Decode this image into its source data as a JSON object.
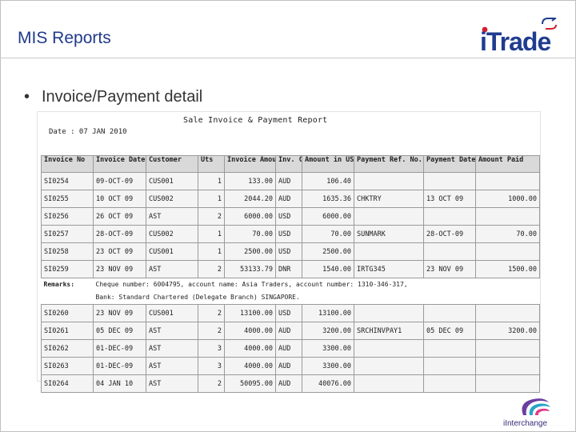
{
  "header": {
    "title": "MIS Reports",
    "logo_text": "iTrade"
  },
  "bullet": {
    "symbol": "•",
    "text": "Invoice/Payment detail"
  },
  "report": {
    "title": "Sale Invoice & Payment Report",
    "date_line": "Date : 07 JAN 2010",
    "columns": [
      "Invoice No",
      "Invoice Date",
      "Customer",
      "Uts",
      "Invoice Amount",
      "Inv. Curr",
      "Amount in USD",
      "Payment Ref. No.",
      "Payment Date",
      "Amount Paid"
    ],
    "rows": [
      {
        "no": "SI0254",
        "date": "09-OCT-09",
        "customer": "CUS001",
        "uts": "1",
        "amount": "133.00",
        "curr": "AUD",
        "usd": "106.40",
        "ref": "",
        "pdate": "",
        "paid": ""
      },
      {
        "no": "SI0255",
        "date": "10 OCT 09",
        "customer": "CUS002",
        "uts": "1",
        "amount": "2044.20",
        "curr": "AUD",
        "usd": "1635.36",
        "ref": "CHKTRY",
        "pdate": "13 OCT 09",
        "paid": "1000.00"
      },
      {
        "no": "SI0256",
        "date": "26 OCT 09",
        "customer": "AST",
        "uts": "2",
        "amount": "6000.00",
        "curr": "USD",
        "usd": "6000.00",
        "ref": "",
        "pdate": "",
        "paid": ""
      },
      {
        "no": "SI0257",
        "date": "28-OCT-09",
        "customer": "CUS002",
        "uts": "1",
        "amount": "70.00",
        "curr": "USD",
        "usd": "70.00",
        "ref": "SUNMARK",
        "pdate": "28-OCT-09",
        "paid": "70.00"
      },
      {
        "no": "SI0258",
        "date": "23 OCT 09",
        "customer": "CUS001",
        "uts": "1",
        "amount": "2500.00",
        "curr": "USD",
        "usd": "2500.00",
        "ref": "",
        "pdate": "",
        "paid": ""
      },
      {
        "no": "SI0259",
        "date": "23 NOV 09",
        "customer": "AST",
        "uts": "2",
        "amount": "53133.79",
        "curr": "DNR",
        "usd": "1540.00",
        "ref": "IRTG345",
        "pdate": "23 NOV 09",
        "paid": "1500.00"
      }
    ],
    "remarks_label": "Remarks:",
    "remarks_line1": "Cheque number: 6004795, account name: Asia Traders, account number: 1310-346-317,",
    "remarks_line2": "Bank: Standard Chartered (Delegate Branch) SINGAPORE.",
    "rows2": [
      {
        "no": "SI0260",
        "date": "23 NOV 09",
        "customer": "CUS001",
        "uts": "2",
        "amount": "13100.00",
        "curr": "USD",
        "usd": "13100.00",
        "ref": "",
        "pdate": "",
        "paid": ""
      },
      {
        "no": "SI0261",
        "date": "05 DEC 09",
        "customer": "AST",
        "uts": "2",
        "amount": "4000.00",
        "curr": "AUD",
        "usd": "3200.00",
        "ref": "SRCHINVPAY1",
        "pdate": "05 DEC 09",
        "paid": "3200.00"
      },
      {
        "no": "SI0262",
        "date": "01-DEC-09",
        "customer": "AST",
        "uts": "3",
        "amount": "4000.00",
        "curr": "AUD",
        "usd": "3300.00",
        "ref": "",
        "pdate": "",
        "paid": ""
      },
      {
        "no": "SI0263",
        "date": "01-DEC-09",
        "customer": "AST",
        "uts": "3",
        "amount": "4000.00",
        "curr": "AUD",
        "usd": "3300.00",
        "ref": "",
        "pdate": "",
        "paid": ""
      },
      {
        "no": "SI0264",
        "date": "04 JAN 10",
        "customer": "AST",
        "uts": "2",
        "amount": "50095.00",
        "curr": "AUD",
        "usd": "40076.00",
        "ref": "",
        "pdate": "",
        "paid": ""
      }
    ]
  },
  "footer": {
    "logo_text": "iInterchange"
  },
  "colors": {
    "title_blue": "#1f3a8a",
    "brand_blue": "#1f3c8f",
    "brand_red": "#d0202e",
    "header_row_gray": "#d9d9d9"
  }
}
